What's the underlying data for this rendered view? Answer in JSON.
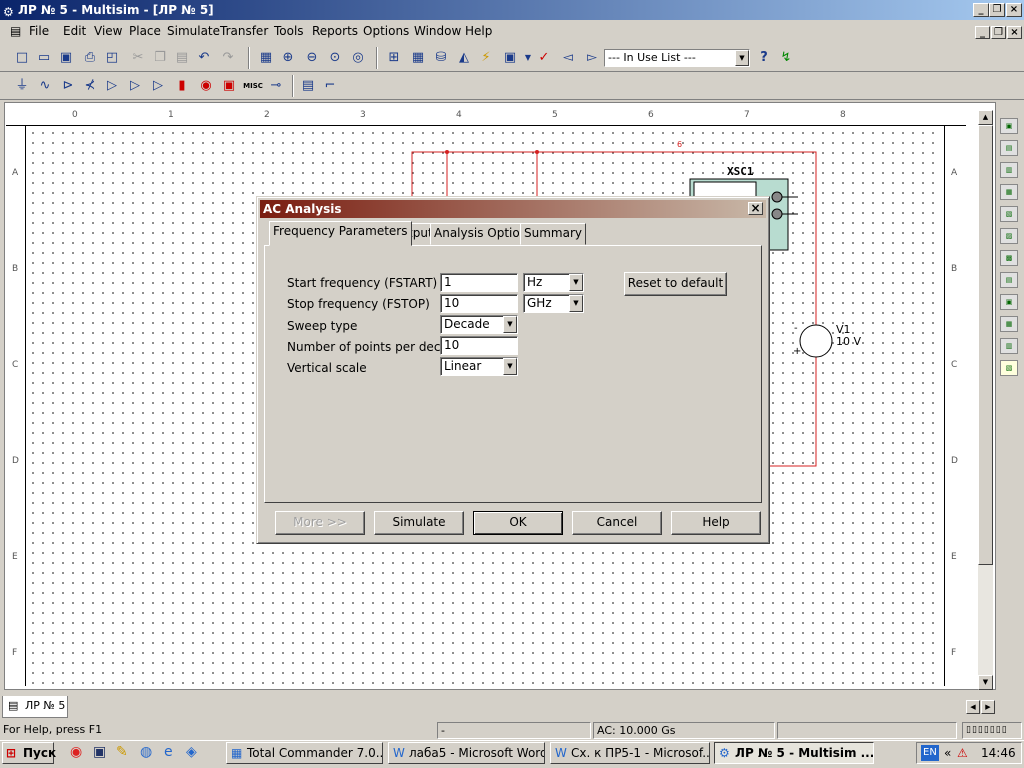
{
  "window": {
    "title": "ЛР № 5 - Multisim - [ЛР № 5]"
  },
  "menu": [
    "File",
    "Edit",
    "View",
    "Place",
    "Simulate",
    "Transfer",
    "Tools",
    "Reports",
    "Options",
    "Window",
    "Help"
  ],
  "toolbar": {
    "in_use_list": "--- In Use List ---",
    "misc_label": "MISC"
  },
  "ruler": {
    "top": [
      "0",
      "1",
      "2",
      "3",
      "4",
      "5",
      "6",
      "7",
      "8"
    ],
    "left": [
      "A",
      "B",
      "C",
      "D",
      "E",
      "F"
    ]
  },
  "schematic": {
    "scope_label": "XSC1",
    "source_name": "V1",
    "source_value": "10 V",
    "net_label": "6",
    "minus": "-",
    "plus": "+"
  },
  "dialog": {
    "title": "AC Analysis",
    "tabs": [
      "Frequency Parameters",
      "Output",
      "Analysis Options",
      "Summary"
    ],
    "fields": {
      "fstart_label": "Start frequency (FSTART)",
      "fstart_value": "1",
      "fstart_unit": "Hz",
      "fstop_label": "Stop frequency (FSTOP)",
      "fstop_value": "10",
      "fstop_unit": "GHz",
      "sweep_label": "Sweep type",
      "sweep_value": "Decade",
      "points_label": "Number of points per decade",
      "points_value": "10",
      "vscale_label": "Vertical scale",
      "vscale_value": "Linear"
    },
    "reset_label": "Reset to default",
    "buttons": {
      "more": "More >>",
      "simulate": "Simulate",
      "ok": "OK",
      "cancel": "Cancel",
      "help": "Help"
    }
  },
  "sheet_tab": "ЛР № 5",
  "status": {
    "help": "For Help, press F1",
    "mid": "-",
    "ac": "AC: 10.000 Gs"
  },
  "taskbar": {
    "start": "Пуск",
    "tasks": [
      "Total Commander 7.0...",
      "лаба5 - Microsoft Word",
      "Сх. к ПР5-1 - Microsof...",
      "ЛР № 5 - Multisim ..."
    ],
    "lang": "EN",
    "arrows": "«",
    "time": "14:46"
  }
}
